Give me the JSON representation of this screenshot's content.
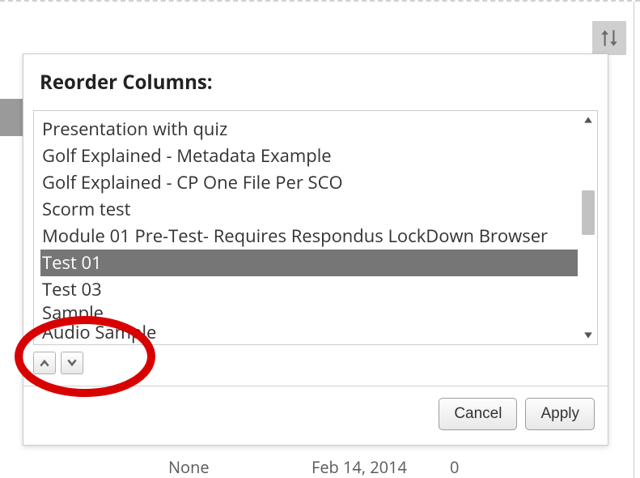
{
  "header": {
    "title": "Reorder Columns:"
  },
  "list": {
    "items": [
      {
        "label": "Presentation with quiz",
        "selected": false
      },
      {
        "label": "Golf Explained - Metadata Example",
        "selected": false
      },
      {
        "label": "Golf Explained - CP One File Per SCO",
        "selected": false
      },
      {
        "label": "Scorm test",
        "selected": false
      },
      {
        "label": "Module 01 Pre-Test- Requires Respondus LockDown Browser",
        "selected": false
      },
      {
        "label": "Test 01",
        "selected": true
      },
      {
        "label": "Test 03",
        "selected": false
      },
      {
        "label": "Sample",
        "selected": false
      },
      {
        "label": "Audio Sample",
        "selected": false
      }
    ]
  },
  "footer": {
    "cancel_label": "Cancel",
    "apply_label": "Apply"
  },
  "background_row": {
    "col0": "None",
    "col1": "Feb 14, 2014",
    "col2": "0"
  }
}
